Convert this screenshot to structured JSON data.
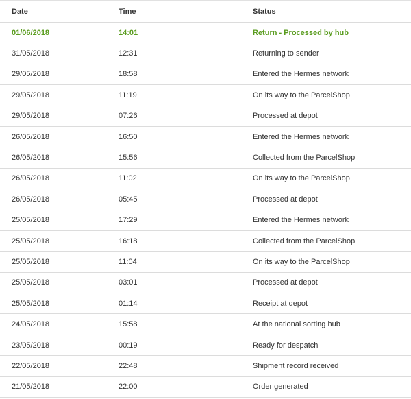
{
  "table": {
    "headers": {
      "date": "Date",
      "time": "Time",
      "status": "Status"
    },
    "highlight_color": "#5a9c1f",
    "rows": [
      {
        "date": "01/06/2018",
        "time": "14:01",
        "status": "Return - Processed by hub",
        "highlight": true
      },
      {
        "date": "31/05/2018",
        "time": "12:31",
        "status": "Returning to sender"
      },
      {
        "date": "29/05/2018",
        "time": "18:58",
        "status": "Entered the Hermes network"
      },
      {
        "date": "29/05/2018",
        "time": "11:19",
        "status": "On its way to the ParcelShop"
      },
      {
        "date": "29/05/2018",
        "time": "07:26",
        "status": "Processed at depot"
      },
      {
        "date": "26/05/2018",
        "time": "16:50",
        "status": "Entered the Hermes network"
      },
      {
        "date": "26/05/2018",
        "time": "15:56",
        "status": "Collected from the ParcelShop"
      },
      {
        "date": "26/05/2018",
        "time": "11:02",
        "status": "On its way to the ParcelShop"
      },
      {
        "date": "26/05/2018",
        "time": "05:45",
        "status": "Processed at depot"
      },
      {
        "date": "25/05/2018",
        "time": "17:29",
        "status": "Entered the Hermes network"
      },
      {
        "date": "25/05/2018",
        "time": "16:18",
        "status": "Collected from the ParcelShop"
      },
      {
        "date": "25/05/2018",
        "time": "11:04",
        "status": "On its way to the ParcelShop"
      },
      {
        "date": "25/05/2018",
        "time": "03:01",
        "status": "Processed at depot"
      },
      {
        "date": "25/05/2018",
        "time": "01:14",
        "status": "Receipt at depot"
      },
      {
        "date": "24/05/2018",
        "time": "15:58",
        "status": "At the national sorting hub"
      },
      {
        "date": "23/05/2018",
        "time": "00:19",
        "status": "Ready for despatch"
      },
      {
        "date": "22/05/2018",
        "time": "22:48",
        "status": "Shipment record received"
      },
      {
        "date": "21/05/2018",
        "time": "22:00",
        "status": "Order generated"
      }
    ]
  }
}
